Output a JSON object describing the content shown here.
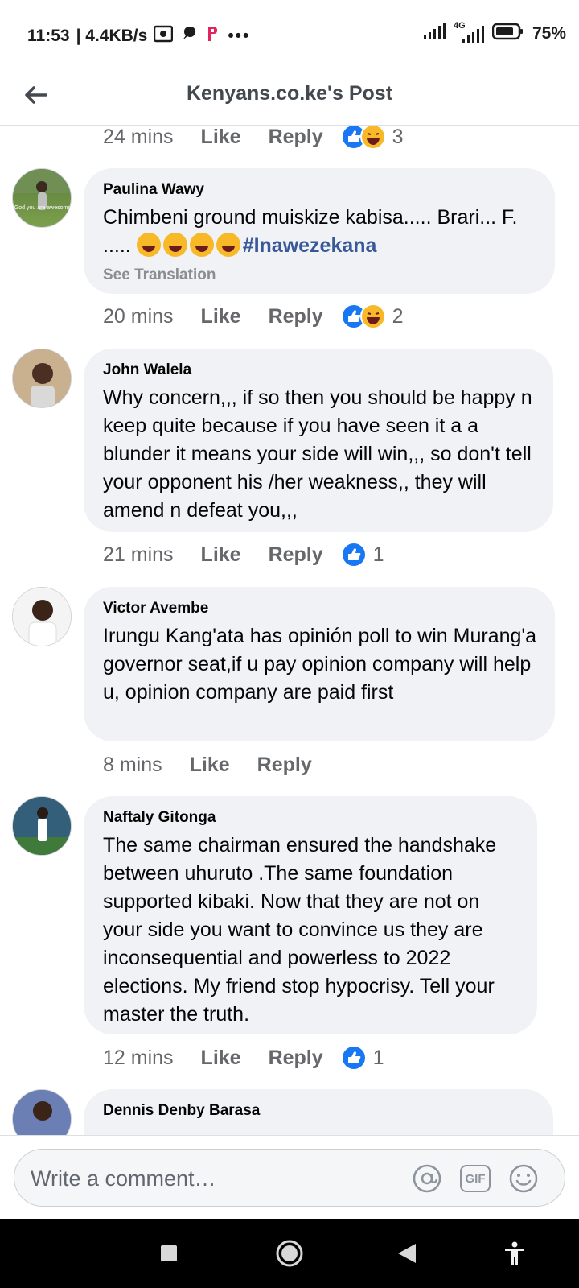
{
  "status_bar": {
    "time": "11:53",
    "net_speed": "| 4.4KB/s",
    "more": "•••",
    "network_label": "4G",
    "battery": "75%"
  },
  "header": {
    "title": "Kenyans.co.ke's Post"
  },
  "colors": {
    "like_blue": "#1877f2",
    "hashtag": "#385898",
    "bubble_bg": "#f0f2f5",
    "meta_gray": "#65676b"
  },
  "labels": {
    "like": "Like",
    "reply": "Reply",
    "see_translation": "See Translation"
  },
  "top_actions": {
    "time": "24 mins",
    "reaction_count": "3",
    "reactions": [
      "like-icon",
      "haha-icon"
    ]
  },
  "comments": [
    {
      "author": "Paulina Wawy",
      "avatar_caption": "God you are awesome",
      "text": "Chimbeni ground muiskize kabisa..... Brari... F. .....",
      "emoji_count": 4,
      "hashtag": "#Inawezekana",
      "time": "20 mins",
      "reaction_count": "2"
    },
    {
      "author": "John Walela",
      "text": "Why concern,,, if so then you should be happy n keep quite because if you have seen it a a blunder it means your side will win,,, so don't tell your opponent his /her weakness,, they will amend n defeat you,,,",
      "time": "21 mins",
      "reaction_count": "1"
    },
    {
      "author": "Victor Avembe",
      "text": "Irungu Kang'ata has opinión poll to win Murang'a governor seat,if u pay opinion company will help u, opinion company are paid first",
      "time": "8 mins",
      "reaction_count": ""
    },
    {
      "author": "Naftaly Gitonga",
      "text": "The same chairman ensured the handshake between uhuruto .The same foundation supported kibaki. Now that they are not on your side you want to convince us they are inconsequential and powerless to 2022 elections. My friend stop hypocrisy. Tell your master the truth.",
      "time": "12 mins",
      "reaction_count": "1"
    },
    {
      "author": "Dennis Denby Barasa"
    }
  ],
  "composer": {
    "placeholder": "Write a comment…",
    "gif_label": "GIF"
  },
  "nav": {
    "buttons": [
      "recents-icon",
      "home-icon",
      "back-icon",
      "accessibility-icon"
    ]
  }
}
